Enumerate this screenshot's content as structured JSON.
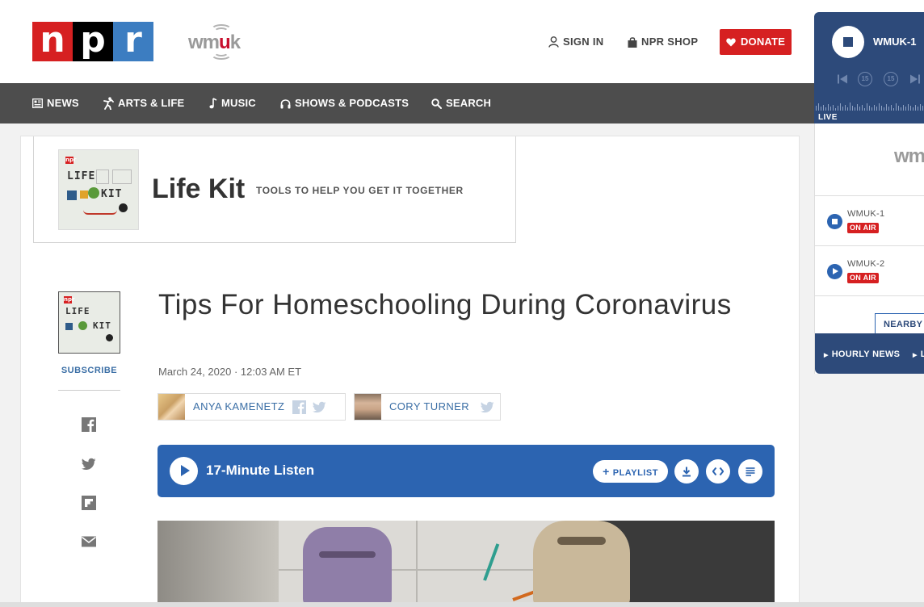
{
  "header": {
    "brand_letters": [
      "n",
      "p",
      "r"
    ],
    "station_logo": {
      "text_left": "wm",
      "text_accent": "u",
      "text_right": "k"
    },
    "sign_in": "SIGN IN",
    "shop": "NPR SHOP",
    "donate": "DONATE"
  },
  "nav": {
    "items": [
      {
        "label": "NEWS",
        "icon": "news-icon"
      },
      {
        "label": "ARTS & LIFE",
        "icon": "arts-icon"
      },
      {
        "label": "MUSIC",
        "icon": "music-note-icon"
      },
      {
        "label": "SHOWS & PODCASTS",
        "icon": "headphones-icon"
      },
      {
        "label": "SEARCH",
        "icon": "search-icon"
      }
    ]
  },
  "series": {
    "art": {
      "brand": "npr",
      "line1": "LIFE",
      "line2": "KIT"
    },
    "title": "Life Kit",
    "tagline": "TOOLS TO HELP YOU GET IT TOGETHER"
  },
  "sidebar": {
    "subscribe": "SUBSCRIBE",
    "share_icons": [
      "facebook-icon",
      "twitter-icon",
      "flipboard-icon",
      "email-icon"
    ]
  },
  "article": {
    "headline": "Tips For Homeschooling During Coronavirus",
    "dateline": "March 24, 2020 · 12:03 AM ET",
    "authors": [
      {
        "name": "ANYA KAMENETZ"
      },
      {
        "name": "CORY TURNER"
      }
    ]
  },
  "player": {
    "listen_label": "17-Minute Listen",
    "playlist": "PLAYLIST"
  },
  "live": {
    "station": "WMUK-1",
    "live_tag": "LIVE",
    "skip_back": "15",
    "skip_fwd": "15"
  },
  "stations": {
    "logo": "wm",
    "list": [
      {
        "name": "WMUK-1",
        "status": "ON AIR"
      },
      {
        "name": "WMUK-2",
        "status": "ON AIR"
      }
    ],
    "nearby": "NEARBY",
    "hourly_news": "HOURLY NEWS",
    "next_link": "L"
  },
  "colors": {
    "npr_red": "#d62021",
    "npr_blue": "#3c7dc1",
    "nav_gray": "#4d4d4d",
    "player_blue": "#2c64b1",
    "live_navy": "#2d4a7a",
    "link_blue": "#3a6ea5"
  }
}
